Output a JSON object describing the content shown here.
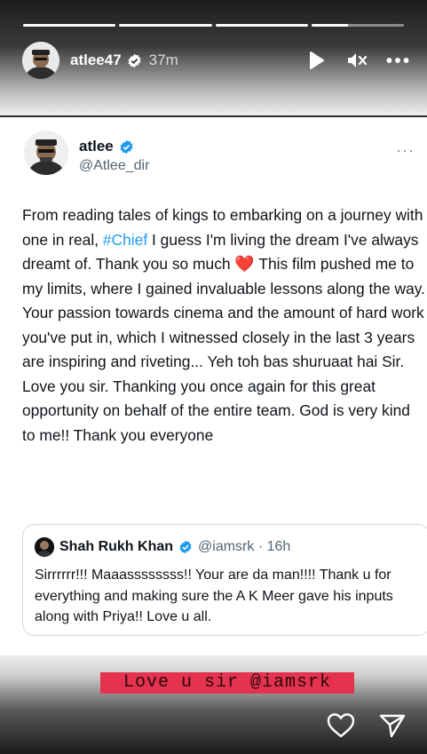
{
  "story": {
    "progress": [
      1,
      1,
      1,
      0.4
    ],
    "username": "atlee47",
    "time": "37m",
    "icons": {
      "play": "play-icon",
      "mute": "mute-icon",
      "more": "more-icon",
      "like": "heart-icon",
      "share": "send-icon"
    }
  },
  "tweet": {
    "name": "atlee",
    "handle": "@Atlee_dir",
    "more": "···",
    "body": {
      "part1": "From reading tales of kings to embarking on a journey with one in real, ",
      "hashtag": "#Chief",
      "part2": " I guess I'm living the dream I've always dreamt of. Thank you so much ",
      "emoji": "❤️",
      "part3": " This film pushed me to my limits, where I gained invaluable lessons along the way. Your passion towards cinema and the amount of hard work you've put in, which I witnessed closely in the last 3 years are inspiring and riveting... Yeh toh bas shuruaat hai Sir. Love you sir. Thanking you once again for this great opportunity on behalf of the entire team. God is very kind to me!! Thank you everyone"
    },
    "quote": {
      "name": "Shah Rukh Khan",
      "handle": "@iamsrk · 16h",
      "text": "Sirrrrrr!!! Maaassssssss!! Your are da man!!!! Thank u for everything and making sure the A K Meer gave his inputs along with Priya!! Love u all."
    }
  },
  "sticker": {
    "text": "Love u sir @iamsrk",
    "color": "#e5334f"
  },
  "colors": {
    "link": "#1d9bf0",
    "verified": "#1d9bf0"
  }
}
